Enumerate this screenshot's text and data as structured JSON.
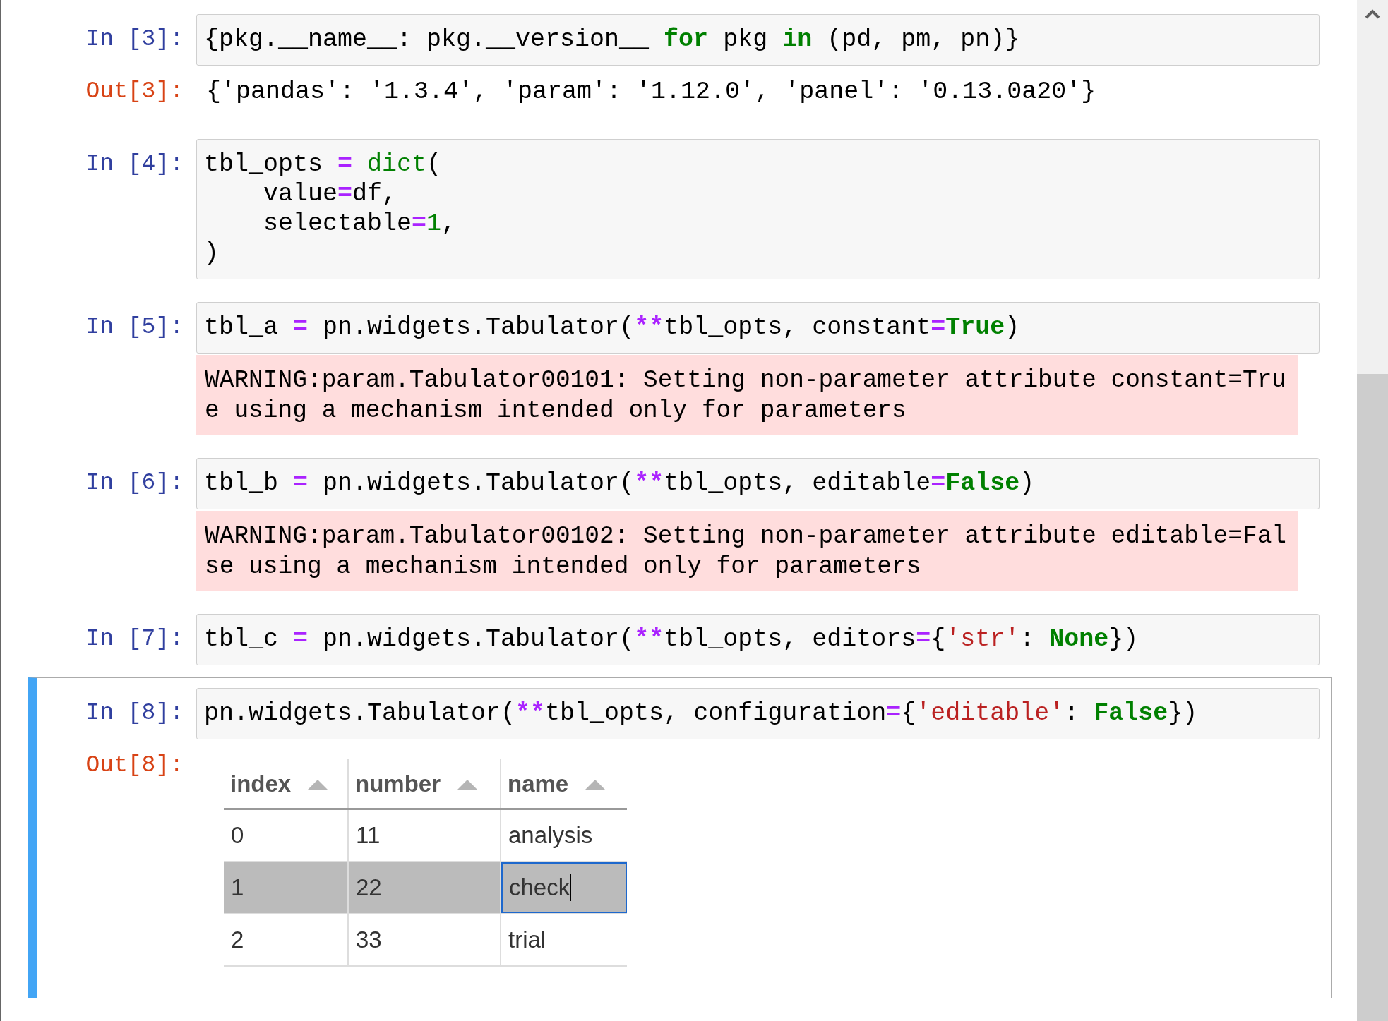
{
  "cells": [
    {
      "prompt": "In [3]:",
      "selected": false,
      "code": [
        [
          {
            "kind": "plain",
            "text": "{pkg.__name__: pkg.__version__ "
          },
          {
            "kind": "keyword",
            "text": "for"
          },
          {
            "kind": "plain",
            "text": " pkg "
          },
          {
            "kind": "keyword",
            "text": "in"
          },
          {
            "kind": "plain",
            "text": " (pd, pm, pn)}"
          }
        ]
      ],
      "outputs": [
        {
          "kind": "result",
          "prompt": "Out[3]:",
          "text": "{'pandas': '1.3.4', 'param': '1.12.0', 'panel': '0.13.0a20'}"
        }
      ]
    },
    {
      "prompt": "In [4]:",
      "selected": false,
      "code": [
        [
          {
            "kind": "plain",
            "text": "tbl_opts "
          },
          {
            "kind": "operator",
            "text": "="
          },
          {
            "kind": "builtin",
            "text": " dict"
          },
          {
            "kind": "plain",
            "text": "("
          }
        ],
        [
          {
            "kind": "plain",
            "text": "    value"
          },
          {
            "kind": "operator",
            "text": "="
          },
          {
            "kind": "plain",
            "text": "df,"
          }
        ],
        [
          {
            "kind": "plain",
            "text": "    selectable"
          },
          {
            "kind": "operator",
            "text": "="
          },
          {
            "kind": "number",
            "text": "1"
          },
          {
            "kind": "plain",
            "text": ","
          }
        ],
        [
          {
            "kind": "plain",
            "text": ")"
          }
        ]
      ]
    },
    {
      "prompt": "In [5]:",
      "selected": false,
      "code": [
        [
          {
            "kind": "plain",
            "text": "tbl_a "
          },
          {
            "kind": "operator",
            "text": "="
          },
          {
            "kind": "plain",
            "text": " pn.widgets.Tabulator("
          },
          {
            "kind": "operator",
            "text": "**"
          },
          {
            "kind": "plain",
            "text": "tbl_opts, constant"
          },
          {
            "kind": "operator",
            "text": "="
          },
          {
            "kind": "constant",
            "text": "True"
          },
          {
            "kind": "plain",
            "text": ")"
          }
        ]
      ],
      "outputs": [
        {
          "kind": "stderr",
          "text": "WARNING:param.Tabulator00101: Setting non-parameter attribute constant=True using a mechanism intended only for parameters"
        }
      ]
    },
    {
      "prompt": "In [6]:",
      "selected": false,
      "code": [
        [
          {
            "kind": "plain",
            "text": "tbl_b "
          },
          {
            "kind": "operator",
            "text": "="
          },
          {
            "kind": "plain",
            "text": " pn.widgets.Tabulator("
          },
          {
            "kind": "operator",
            "text": "**"
          },
          {
            "kind": "plain",
            "text": "tbl_opts, editable"
          },
          {
            "kind": "operator",
            "text": "="
          },
          {
            "kind": "constant",
            "text": "False"
          },
          {
            "kind": "plain",
            "text": ")"
          }
        ]
      ],
      "outputs": [
        {
          "kind": "stderr",
          "text": "WARNING:param.Tabulator00102: Setting non-parameter attribute editable=False using a mechanism intended only for parameters"
        }
      ]
    },
    {
      "prompt": "In [7]:",
      "selected": false,
      "code": [
        [
          {
            "kind": "plain",
            "text": "tbl_c "
          },
          {
            "kind": "operator",
            "text": "="
          },
          {
            "kind": "plain",
            "text": " pn.widgets.Tabulator("
          },
          {
            "kind": "operator",
            "text": "**"
          },
          {
            "kind": "plain",
            "text": "tbl_opts, editors"
          },
          {
            "kind": "operator",
            "text": "="
          },
          {
            "kind": "plain",
            "text": "{"
          },
          {
            "kind": "string",
            "text": "'str'"
          },
          {
            "kind": "plain",
            "text": ": "
          },
          {
            "kind": "constant",
            "text": "None"
          },
          {
            "kind": "plain",
            "text": "})"
          }
        ]
      ]
    },
    {
      "prompt": "In [8]:",
      "selected": true,
      "code": [
        [
          {
            "kind": "plain",
            "text": "pn.widgets.Tabulator("
          },
          {
            "kind": "operator",
            "text": "**"
          },
          {
            "kind": "plain",
            "text": "tbl_opts, configuration"
          },
          {
            "kind": "operator",
            "text": "="
          },
          {
            "kind": "plain",
            "text": "{"
          },
          {
            "kind": "string",
            "text": "'editable'"
          },
          {
            "kind": "plain",
            "text": ": "
          },
          {
            "kind": "constant",
            "text": "False"
          },
          {
            "kind": "plain",
            "text": "})"
          }
        ]
      ],
      "outputs": [
        {
          "kind": "table",
          "prompt": "Out[8]:",
          "columns": [
            "index",
            "number",
            "name"
          ],
          "rows": [
            {
              "selected": false,
              "cells": [
                {
                  "text": "0",
                  "editing": false
                },
                {
                  "text": "11",
                  "editing": false
                },
                {
                  "text": "analysis",
                  "editing": false
                }
              ]
            },
            {
              "selected": true,
              "cells": [
                {
                  "text": "1",
                  "editing": false
                },
                {
                  "text": "22",
                  "editing": false
                },
                {
                  "text": "check",
                  "editing": true
                }
              ]
            },
            {
              "selected": false,
              "cells": [
                {
                  "text": "2",
                  "editing": false
                },
                {
                  "text": "33",
                  "editing": false
                },
                {
                  "text": "trial",
                  "editing": false
                }
              ]
            }
          ]
        }
      ]
    }
  ]
}
